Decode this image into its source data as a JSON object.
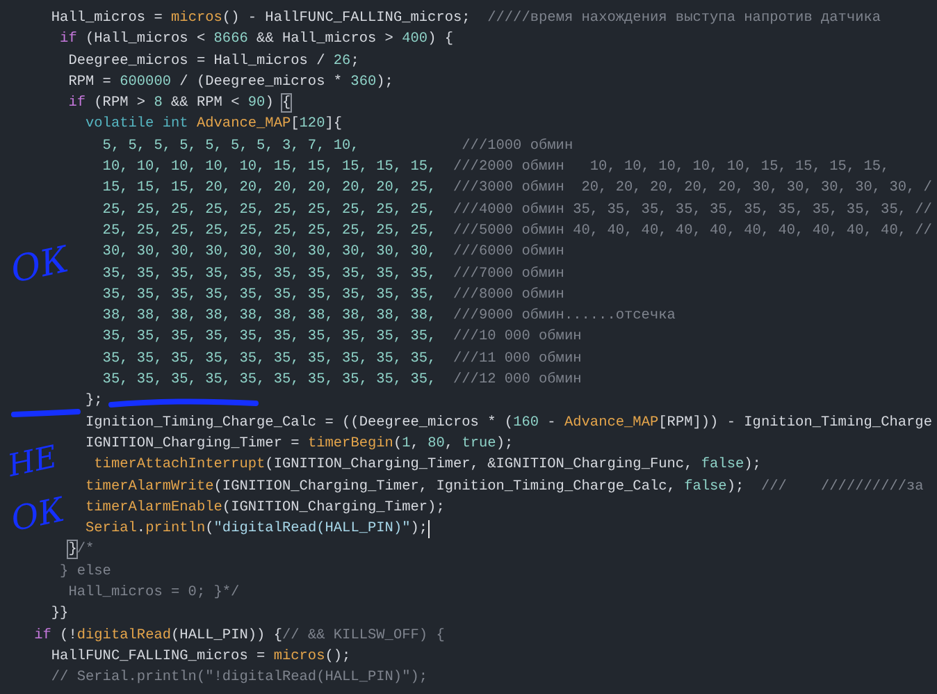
{
  "editor": {
    "lines": [
      {
        "cursor": false,
        "tokens": [
          {
            "kind": "plain",
            "text": "Hall_micros = "
          },
          {
            "kind": "function",
            "text": "micros"
          },
          {
            "kind": "plain",
            "text": "() - HallFUNC_FALLING_micros;  "
          },
          {
            "kind": "comment",
            "text": "/////время нахождения выступа напротив датчика"
          }
        ]
      },
      {
        "cursor": false,
        "tokens": [
          {
            "kind": "keyword",
            "text": "if"
          },
          {
            "kind": "plain",
            "text": " (Hall_micros < "
          },
          {
            "kind": "number",
            "text": "8666"
          },
          {
            "kind": "plain",
            "text": " && Hall_micros > "
          },
          {
            "kind": "number",
            "text": "400"
          },
          {
            "kind": "plain",
            "text": ") {"
          }
        ]
      },
      {
        "cursor": false,
        "tokens": [
          {
            "kind": "plain",
            "text": "Deegree_micros = Hall_micros / "
          },
          {
            "kind": "number",
            "text": "26"
          },
          {
            "kind": "plain",
            "text": ";"
          }
        ]
      },
      {
        "cursor": false,
        "tokens": [
          {
            "kind": "plain",
            "text": "RPM = "
          },
          {
            "kind": "number",
            "text": "600000"
          },
          {
            "kind": "plain",
            "text": " / (Deegree_micros * "
          },
          {
            "kind": "number",
            "text": "360"
          },
          {
            "kind": "plain",
            "text": ");"
          }
        ]
      },
      {
        "cursor": false,
        "tokens": [
          {
            "kind": "keyword",
            "text": "if"
          },
          {
            "kind": "plain",
            "text": " (RPM > "
          },
          {
            "kind": "number",
            "text": "8"
          },
          {
            "kind": "plain",
            "text": " && RPM < "
          },
          {
            "kind": "number",
            "text": "90"
          },
          {
            "kind": "plain",
            "text": ") "
          },
          {
            "kind": "bracket_match",
            "text": "{"
          }
        ]
      },
      {
        "cursor": false,
        "tokens": [
          {
            "kind": "type",
            "text": "volatile int"
          },
          {
            "kind": "function",
            "text": " Advance_MAP"
          },
          {
            "kind": "plain",
            "text": "["
          },
          {
            "kind": "number",
            "text": "120"
          },
          {
            "kind": "plain",
            "text": "]{"
          }
        ]
      },
      {
        "cursor": false,
        "tokens": [
          {
            "kind": "number",
            "text": "5, 5, 5, 5, 5, 5, 5, 3, 7, 10,"
          },
          {
            "kind": "comment",
            "text": "            ///1000 обмин"
          }
        ]
      },
      {
        "cursor": false,
        "tokens": [
          {
            "kind": "number",
            "text": "10, 10, 10, 10, 10, 15, 15, 15, 15, 15,"
          },
          {
            "kind": "comment",
            "text": "  ///2000 обмин   10, 10, 10, 10, 10, 15, 15, 15, 15,"
          }
        ]
      },
      {
        "cursor": false,
        "tokens": [
          {
            "kind": "number",
            "text": "15, 15, 15, 20, 20, 20, 20, 20, 20, 25,"
          },
          {
            "kind": "comment",
            "text": "  ///3000 обмин  20, 20, 20, 20, 20, 30, 30, 30, 30, 30, /"
          }
        ]
      },
      {
        "cursor": false,
        "tokens": [
          {
            "kind": "number",
            "text": "25, 25, 25, 25, 25, 25, 25, 25, 25, 25,"
          },
          {
            "kind": "comment",
            "text": "  ///4000 обмин 35, 35, 35, 35, 35, 35, 35, 35, 35, 35, //"
          }
        ]
      },
      {
        "cursor": false,
        "tokens": [
          {
            "kind": "number",
            "text": "25, 25, 25, 25, 25, 25, 25, 25, 25, 25,"
          },
          {
            "kind": "comment",
            "text": "  ///5000 обмин 40, 40, 40, 40, 40, 40, 40, 40, 40, 40, //"
          }
        ]
      },
      {
        "cursor": false,
        "tokens": [
          {
            "kind": "number",
            "text": "30, 30, 30, 30, 30, 30, 30, 30, 30, 30,"
          },
          {
            "kind": "comment",
            "text": "  ///6000 обмин"
          }
        ]
      },
      {
        "cursor": false,
        "tokens": [
          {
            "kind": "number",
            "text": "35, 35, 35, 35, 35, 35, 35, 35, 35, 35,"
          },
          {
            "kind": "comment",
            "text": "  ///7000 обмин"
          }
        ]
      },
      {
        "cursor": false,
        "tokens": [
          {
            "kind": "number",
            "text": "35, 35, 35, 35, 35, 35, 35, 35, 35, 35,"
          },
          {
            "kind": "comment",
            "text": "  ///8000 обмин"
          }
        ]
      },
      {
        "cursor": false,
        "tokens": [
          {
            "kind": "number",
            "text": "38, 38, 38, 38, 38, 38, 38, 38, 38, 38,"
          },
          {
            "kind": "comment",
            "text": "  ///9000 обмин......отсечка"
          }
        ]
      },
      {
        "cursor": false,
        "tokens": [
          {
            "kind": "number",
            "text": "35, 35, 35, 35, 35, 35, 35, 35, 35, 35,"
          },
          {
            "kind": "comment",
            "text": "  ///10 000 обмин"
          }
        ]
      },
      {
        "cursor": false,
        "tokens": [
          {
            "kind": "number",
            "text": "35, 35, 35, 35, 35, 35, 35, 35, 35, 35,"
          },
          {
            "kind": "comment",
            "text": "  ///11 000 обмин"
          }
        ]
      },
      {
        "cursor": false,
        "tokens": [
          {
            "kind": "number",
            "text": "35, 35, 35, 35, 35, 35, 35, 35, 35, 35,"
          },
          {
            "kind": "comment",
            "text": "  ///12 000 обмин"
          }
        ]
      },
      {
        "cursor": false,
        "tokens": [
          {
            "kind": "plain",
            "text": "};"
          }
        ]
      },
      {
        "cursor": false,
        "tokens": [
          {
            "kind": "plain",
            "text": "Ignition_Timing_Charge_Calc = ((Deegree_micros * ("
          },
          {
            "kind": "number",
            "text": "160"
          },
          {
            "kind": "plain",
            "text": " - "
          },
          {
            "kind": "function",
            "text": "Advance_MAP"
          },
          {
            "kind": "plain",
            "text": "[RPM])) - Ignition_Timing_Charge"
          }
        ]
      },
      {
        "cursor": false,
        "tokens": [
          {
            "kind": "plain",
            "text": "IGNITION_Charging_Timer = "
          },
          {
            "kind": "function",
            "text": "timerBegin"
          },
          {
            "kind": "plain",
            "text": "("
          },
          {
            "kind": "number",
            "text": "1"
          },
          {
            "kind": "plain",
            "text": ", "
          },
          {
            "kind": "number",
            "text": "80"
          },
          {
            "kind": "plain",
            "text": ", "
          },
          {
            "kind": "number",
            "text": "true"
          },
          {
            "kind": "plain",
            "text": ");"
          }
        ]
      },
      {
        "cursor": false,
        "tokens": [
          {
            "kind": "function",
            "text": "timerAttachInterrupt"
          },
          {
            "kind": "plain",
            "text": "(IGNITION_Charging_Timer, &IGNITION_Charging_Func, "
          },
          {
            "kind": "number",
            "text": "false"
          },
          {
            "kind": "plain",
            "text": ");"
          }
        ]
      },
      {
        "cursor": false,
        "tokens": [
          {
            "kind": "function",
            "text": "timerAlarmWrite"
          },
          {
            "kind": "plain",
            "text": "(IGNITION_Charging_Timer, Ignition_Timing_Charge_Calc, "
          },
          {
            "kind": "number",
            "text": "false"
          },
          {
            "kind": "plain",
            "text": ");  "
          },
          {
            "kind": "comment",
            "text": "///    //////////за"
          }
        ]
      },
      {
        "cursor": false,
        "tokens": [
          {
            "kind": "function",
            "text": "timerAlarmEnable"
          },
          {
            "kind": "plain",
            "text": "(IGNITION_Charging_Timer);"
          }
        ]
      },
      {
        "cursor": true,
        "tokens": [
          {
            "kind": "function",
            "text": "Serial"
          },
          {
            "kind": "plain",
            "text": "."
          },
          {
            "kind": "function",
            "text": "println"
          },
          {
            "kind": "plain",
            "text": "("
          },
          {
            "kind": "string",
            "text": "\"digitalRead(HALL_PIN)\""
          },
          {
            "kind": "plain",
            "text": ");"
          }
        ]
      },
      {
        "cursor": false,
        "tokens": [
          {
            "kind": "bracket_match",
            "text": "}"
          },
          {
            "kind": "comment",
            "text": "/*"
          }
        ]
      },
      {
        "cursor": false,
        "tokens": [
          {
            "kind": "comment",
            "text": "} else"
          }
        ]
      },
      {
        "cursor": false,
        "tokens": [
          {
            "kind": "comment",
            "text": "Hall_micros = 0; }*/"
          }
        ]
      },
      {
        "cursor": false,
        "tokens": [
          {
            "kind": "plain",
            "text": "}}"
          }
        ]
      },
      {
        "cursor": false,
        "tokens": [
          {
            "kind": "keyword",
            "text": "if"
          },
          {
            "kind": "plain",
            "text": " (!"
          },
          {
            "kind": "function",
            "text": "digitalRead"
          },
          {
            "kind": "plain",
            "text": "(HALL_PIN)) {"
          },
          {
            "kind": "comment",
            "text": "// && KILLSW_OFF) {"
          }
        ]
      },
      {
        "cursor": false,
        "tokens": [
          {
            "kind": "plain",
            "text": "HallFUNC_FALLING_micros = "
          },
          {
            "kind": "function",
            "text": "micros"
          },
          {
            "kind": "plain",
            "text": "();"
          }
        ]
      },
      {
        "cursor": false,
        "tokens": [
          {
            "kind": "comment",
            "text": "// Serial.println(\"!digitalRead(HALL_PIN)\");"
          }
        ]
      }
    ]
  },
  "annotations": [
    {
      "kind": "text",
      "text": "ОК"
    },
    {
      "kind": "stroke"
    },
    {
      "kind": "text",
      "text": "НЕ"
    },
    {
      "kind": "text",
      "text": "ОК"
    }
  ]
}
